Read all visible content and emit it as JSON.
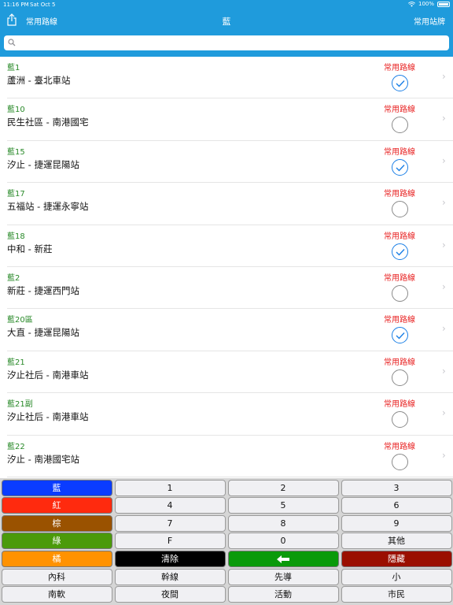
{
  "status": {
    "time": "11:16 PM",
    "date": "Sat Oct 5",
    "battery": "100%"
  },
  "nav": {
    "left": "常用路線",
    "title": "藍",
    "right": "常用站牌"
  },
  "search": {
    "placeholder": "",
    "value": ""
  },
  "routes": [
    {
      "code": "藍1",
      "name": "蘆洲 - 臺北車站",
      "fav_label": "常用路線",
      "checked": true
    },
    {
      "code": "藍10",
      "name": "民生社區 - 南港國宅",
      "fav_label": "常用路線",
      "checked": false
    },
    {
      "code": "藍15",
      "name": "汐止 - 捷運昆陽站",
      "fav_label": "常用路線",
      "checked": true
    },
    {
      "code": "藍17",
      "name": "五福站 - 捷運永寧站",
      "fav_label": "常用路線",
      "checked": false
    },
    {
      "code": "藍18",
      "name": "中和 - 新莊",
      "fav_label": "常用路線",
      "checked": true
    },
    {
      "code": "藍2",
      "name": "新莊 - 捷運西門站",
      "fav_label": "常用路線",
      "checked": false
    },
    {
      "code": "藍20區",
      "name": "大直 - 捷運昆陽站",
      "fav_label": "常用路線",
      "checked": true
    },
    {
      "code": "藍21",
      "name": "汐止社后 - 南港車站",
      "fav_label": "常用路線",
      "checked": false
    },
    {
      "code": "藍21副",
      "name": "汐止社后 - 南港車站",
      "fav_label": "常用路線",
      "checked": false
    },
    {
      "code": "藍22",
      "name": "汐止 - 南港國宅站",
      "fav_label": "常用路線",
      "checked": false
    }
  ],
  "keypad": [
    [
      {
        "label": "藍",
        "bg": "#0a3cff",
        "fg": "#ffffff"
      },
      {
        "label": "1"
      },
      {
        "label": "2"
      },
      {
        "label": "3"
      }
    ],
    [
      {
        "label": "紅",
        "bg": "#ff2a0e",
        "fg": "#ffffff"
      },
      {
        "label": "4"
      },
      {
        "label": "5"
      },
      {
        "label": "6"
      }
    ],
    [
      {
        "label": "棕",
        "bg": "#9a5200",
        "fg": "#ffffff"
      },
      {
        "label": "7"
      },
      {
        "label": "8"
      },
      {
        "label": "9"
      }
    ],
    [
      {
        "label": "綠",
        "bg": "#4b9a0a",
        "fg": "#ffffff"
      },
      {
        "label": "F"
      },
      {
        "label": "0"
      },
      {
        "label": "其他"
      }
    ],
    [
      {
        "label": "橘",
        "bg": "#ff9200",
        "fg": "#ffffff"
      },
      {
        "label": "清除",
        "bg": "#000000",
        "fg": "#ffffff"
      },
      {
        "label": "",
        "icon": "backspace-arrow-icon",
        "bg": "#0a9a0a",
        "fg": "#ffffff"
      },
      {
        "label": "隱藏",
        "bg": "#9a0f00",
        "fg": "#ffffff"
      }
    ],
    [
      {
        "label": "內科"
      },
      {
        "label": "幹線"
      },
      {
        "label": "先導"
      },
      {
        "label": "小"
      }
    ],
    [
      {
        "label": "南軟"
      },
      {
        "label": "夜間"
      },
      {
        "label": "活動"
      },
      {
        "label": "市民"
      }
    ]
  ],
  "colors": {
    "header": "#1f9bdc",
    "route_code": "#2a8a2a",
    "fav_label": "#e82020",
    "check_on": "#1a7fe6"
  }
}
